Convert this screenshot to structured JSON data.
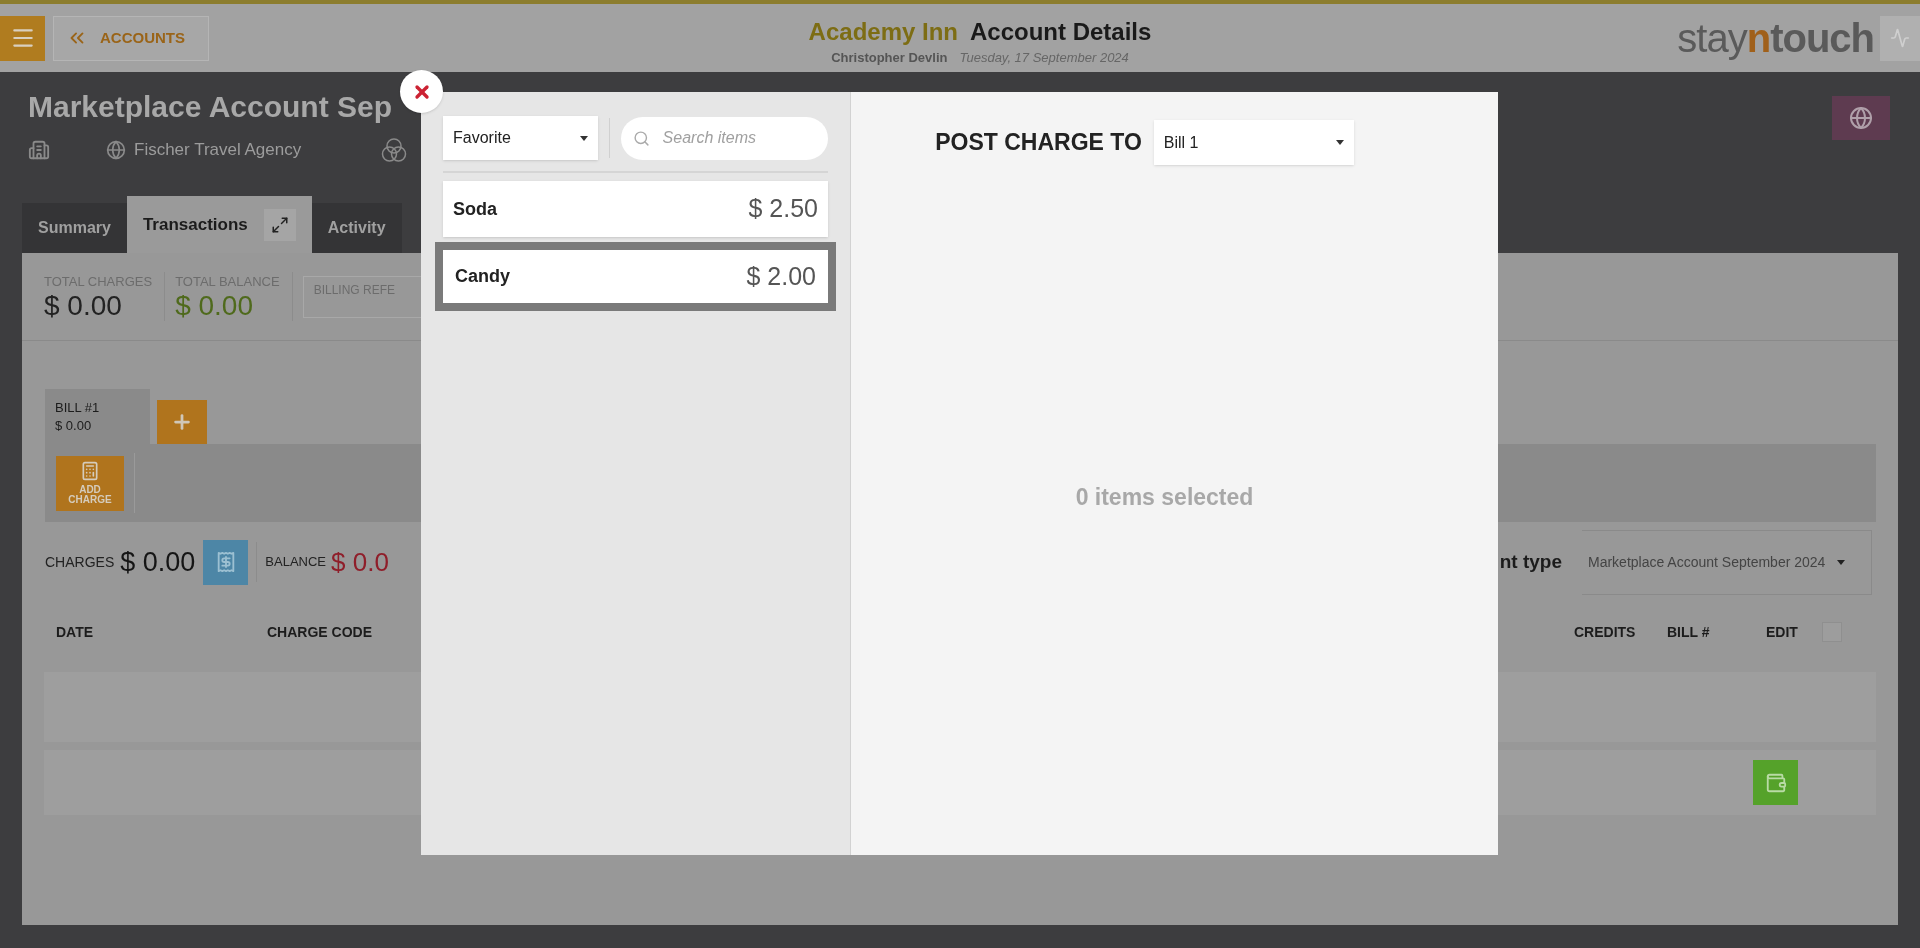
{
  "header": {
    "back_button": "ACCOUNTS",
    "hotel": "Academy Inn",
    "page_title": "Account Details",
    "user": "Christopher Devlin",
    "date": "Tuesday, 17 September 2024",
    "logo": [
      "stay",
      "n",
      "touch"
    ]
  },
  "account": {
    "title": "Marketplace Account Sep",
    "company": "Fischer Travel Agency"
  },
  "tabs": [
    {
      "label": "Summary",
      "selected": false
    },
    {
      "label": "Transactions",
      "selected": true
    },
    {
      "label": "Activity",
      "selected": false
    }
  ],
  "stats": [
    {
      "label": "TOTAL CHARGES",
      "value": "$ 0.00",
      "kind": "plain"
    },
    {
      "label": "TOTAL BALANCE",
      "value": "$ 0.00",
      "kind": "positive"
    }
  ],
  "billing_reference": {
    "label": "BILLING REFE"
  },
  "bills": [
    {
      "label": "BILL #1",
      "amount": "$ 0.00",
      "selected": true
    }
  ],
  "add_charge": "ADD CHARGE",
  "charges": {
    "label": "CHARGES",
    "value": "$ 0.00"
  },
  "balance": {
    "label": "BALANCE",
    "value": "$ 0.0"
  },
  "account_type": {
    "label": "nt type",
    "value": "Marketplace Account September 2024"
  },
  "table": {
    "columns": [
      "DATE",
      "CHARGE CODE",
      "CREDITS",
      "BILL #",
      "EDIT"
    ],
    "select_all": {
      "checked": false
    }
  },
  "modal": {
    "category": "Favorite",
    "search": {
      "placeholder": "Search items"
    },
    "items": [
      {
        "name": "Soda",
        "price": "$ 2.50",
        "selected": false
      },
      {
        "name": "Candy",
        "price": "$ 2.00",
        "selected": true
      }
    ],
    "post_label": "POST CHARGE TO",
    "bill_select": "Bill 1",
    "summary": "0 items selected"
  }
}
